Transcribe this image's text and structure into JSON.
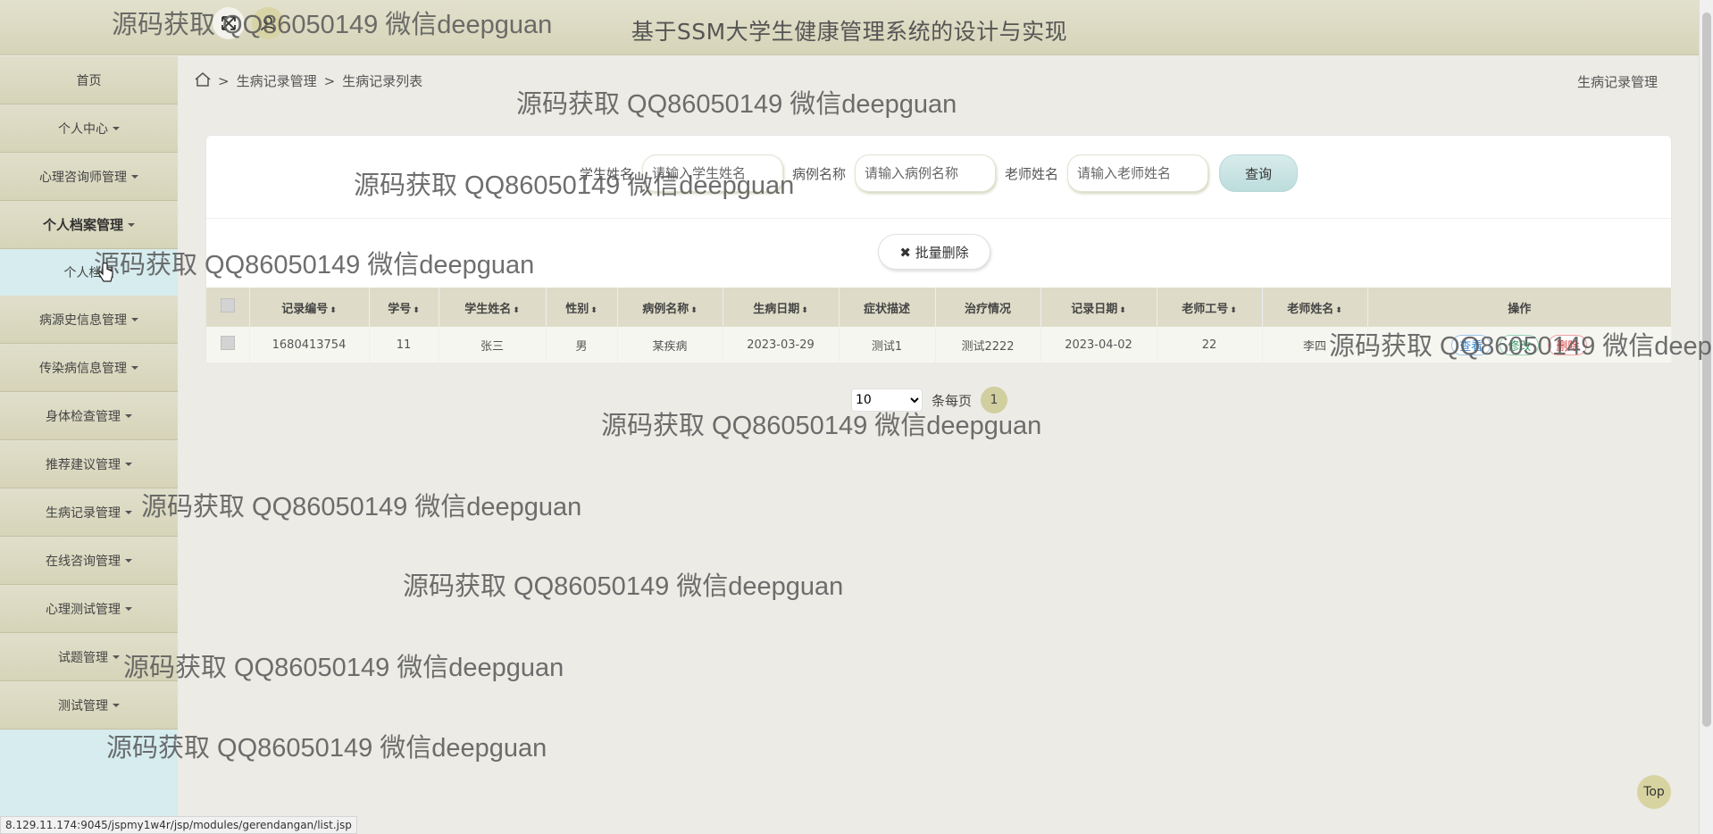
{
  "header": {
    "title": "基于SSM大学生健康管理系统的设计与实现",
    "expand_icon": "expand-arrows-icon",
    "user_icon": "user-icon"
  },
  "sidebar": {
    "items": [
      {
        "label": "首页",
        "caret": false
      },
      {
        "label": "个人中心",
        "caret": true
      },
      {
        "label": "心理咨询师管理",
        "caret": true
      },
      {
        "label": "个人档案管理",
        "caret": true,
        "active": true
      },
      {
        "label": "个人档案",
        "sub": true
      },
      {
        "label": "病源史信息管理",
        "caret": true
      },
      {
        "label": "传染病信息管理",
        "caret": true
      },
      {
        "label": "身体检查管理",
        "caret": true
      },
      {
        "label": "推荐建议管理",
        "caret": true
      },
      {
        "label": "生病记录管理",
        "caret": true
      },
      {
        "label": "在线咨询管理",
        "caret": true
      },
      {
        "label": "心理测试管理",
        "caret": true
      },
      {
        "label": "试题管理",
        "caret": true
      },
      {
        "label": "测试管理",
        "caret": true
      }
    ]
  },
  "breadcrumb": {
    "home_icon": "home-icon",
    "sep": ">",
    "level1": "生病记录管理",
    "level2": "生病记录列表",
    "right": "生病记录管理"
  },
  "search": {
    "student_label": "学生姓名",
    "student_placeholder": "请输入学生姓名",
    "disease_label": "病例名称",
    "disease_placeholder": "请输入病例名称",
    "teacher_label": "老师姓名",
    "teacher_placeholder": "请输入老师姓名",
    "query_button": "查询"
  },
  "batch_delete": "批量删除",
  "table": {
    "headers": [
      "记录编号",
      "学号",
      "学生姓名",
      "性别",
      "病例名称",
      "生病日期",
      "症状描述",
      "治疗情况",
      "记录日期",
      "老师工号",
      "老师姓名",
      "操作"
    ],
    "sortable": [
      true,
      true,
      true,
      true,
      true,
      true,
      false,
      false,
      true,
      true,
      true,
      false
    ],
    "rows": [
      {
        "record_no": "1680413754",
        "student_no": "11",
        "student_name": "张三",
        "gender": "男",
        "disease": "某疾病",
        "sick_date": "2023-03-29",
        "symptom": "测试1",
        "treatment": "测试2222",
        "record_date": "2023-04-02",
        "teacher_no": "22",
        "teacher_name": "李四",
        "actions": {
          "view": "查看",
          "edit": "修改",
          "delete": "删除"
        }
      }
    ]
  },
  "pager": {
    "page_size": "10",
    "per_page_label": "条每页",
    "current_page": "1"
  },
  "top_button": "Top",
  "status_url": "8.129.11.174:9045/jspmy1w4r/jsp/modules/gerendangan/list.jsp",
  "watermark": "源码获取 QQ86050149 微信deepguan"
}
